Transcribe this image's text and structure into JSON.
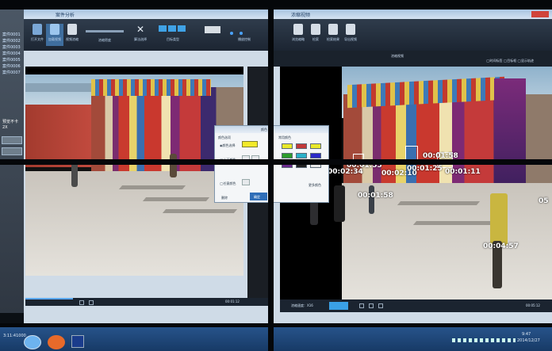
{
  "left_window": {
    "title": "案件分析",
    "toolbar_buttons": [
      {
        "label": "打开文件",
        "icon": "folder-open-icon"
      },
      {
        "label": "加载视频",
        "icon": "video-load-icon"
      },
      {
        "label": "视频浓缩",
        "icon": "condense-icon"
      },
      {
        "label": "浓缩密度",
        "icon": "density-icon"
      },
      {
        "label": "算法选择",
        "icon": "tools-icon"
      },
      {
        "label": "目标类型",
        "icon": "target-type-icon"
      },
      {
        "label": "区域设置",
        "icon": "region-icon"
      },
      {
        "label": "播放控制",
        "icon": "play-control-icon"
      }
    ],
    "status_time": "00:01:12"
  },
  "right_window": {
    "title": "浓缩视频",
    "header_label": "浓缩视频",
    "options": "◯时间标签 ◯目标框 ◯显示轨迹",
    "toolbar_buttons": [
      {
        "label": "浏览缩略",
        "icon": "thumbnail-icon"
      },
      {
        "label": "检索",
        "icon": "search-icon"
      },
      {
        "label": "检索结果",
        "icon": "list-icon"
      },
      {
        "label": "导出视频",
        "icon": "export-icon"
      }
    ],
    "timestamps": [
      "00:01:55",
      "00:01:58",
      "00:02:10",
      "00:01:25",
      "00:01:11",
      "00:02:34",
      "00:01:58",
      "00:04:57",
      "05"
    ],
    "status_left": "浓缩速度：X16",
    "status_time": "00:05:12"
  },
  "color_dialog": {
    "title": "颜色",
    "section_left": "颜色选项",
    "option1": "◉颜色选择",
    "option2": "◯上下颜色",
    "option3": "◯任意颜色",
    "section_right": "常用颜色",
    "btn_left": "删除",
    "btn_right": "更多颜色",
    "btn_ok": "确定",
    "swatch_colors": [
      "#e8e82a",
      "#c23a3a",
      "#e8e82a",
      "#2c9c2c",
      "#2ab0c8",
      "#2a2ac8",
      "#6a2a8c",
      "#222222",
      "#e8e8e8"
    ],
    "selected_color": "#f2ea2a"
  },
  "left_panel": {
    "items": [
      "案件0001",
      "案件0002",
      "案件0003",
      "案件0004",
      "案件0005",
      "案件0006",
      "案件0007"
    ],
    "label_a": "预览不卡",
    "label_b": "2X"
  },
  "taskbar": {
    "clock": "9:47",
    "date": "2014/12/27",
    "left_time": "3:11:41000"
  }
}
